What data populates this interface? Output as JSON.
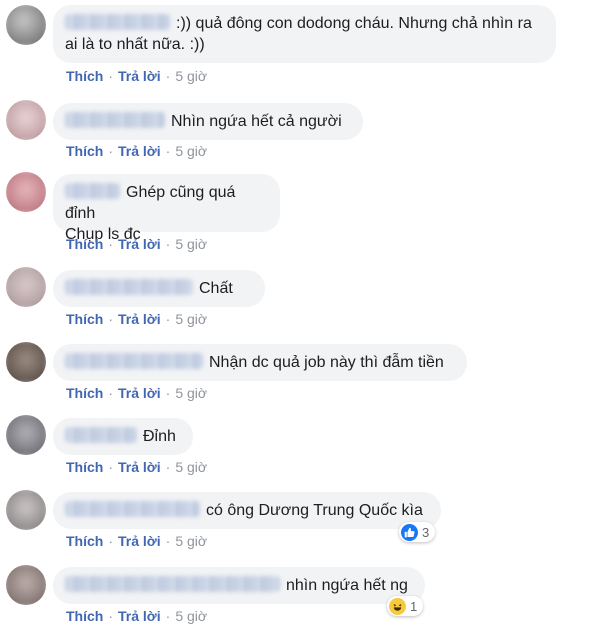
{
  "actions": {
    "like": "Thích",
    "reply": "Trả lời",
    "separator": "·"
  },
  "comments": [
    {
      "text": ":)) quả đông con dodong cháu. Nhưng chả nhìn ra\nai là to nhất nữa. :))",
      "time": "5 giờ",
      "avatar_color": "#8a8a8a"
    },
    {
      "text": "Nhìn ngứa hết cả người",
      "time": "5 giờ",
      "avatar_color": "#c9a9ad"
    },
    {
      "text": "Ghép cũng quá đỉnh\nChụp ls đc",
      "time": "5 giờ",
      "avatar_color": "#c7868f"
    },
    {
      "text": "Chất",
      "time": "5 giờ",
      "avatar_color": "#b9a7a9"
    },
    {
      "text": "Nhận dc quả job này thì đẫm tiền",
      "time": "5 giờ",
      "avatar_color": "#6b5e56"
    },
    {
      "text": "Đỉnh",
      "time": "5 giờ",
      "avatar_color": "#7d7d83"
    },
    {
      "text": "có ông Dương Trung Quốc kìa",
      "time": "5 giờ",
      "avatar_color": "#9a9595",
      "reaction": {
        "icon": "like-icon",
        "count": "3"
      }
    },
    {
      "text": "nhìn ngứa hết ng",
      "time": "5 giờ",
      "avatar_color": "#8d7f7c",
      "reaction": {
        "icon": "haha-icon",
        "count": "1"
      }
    }
  ]
}
